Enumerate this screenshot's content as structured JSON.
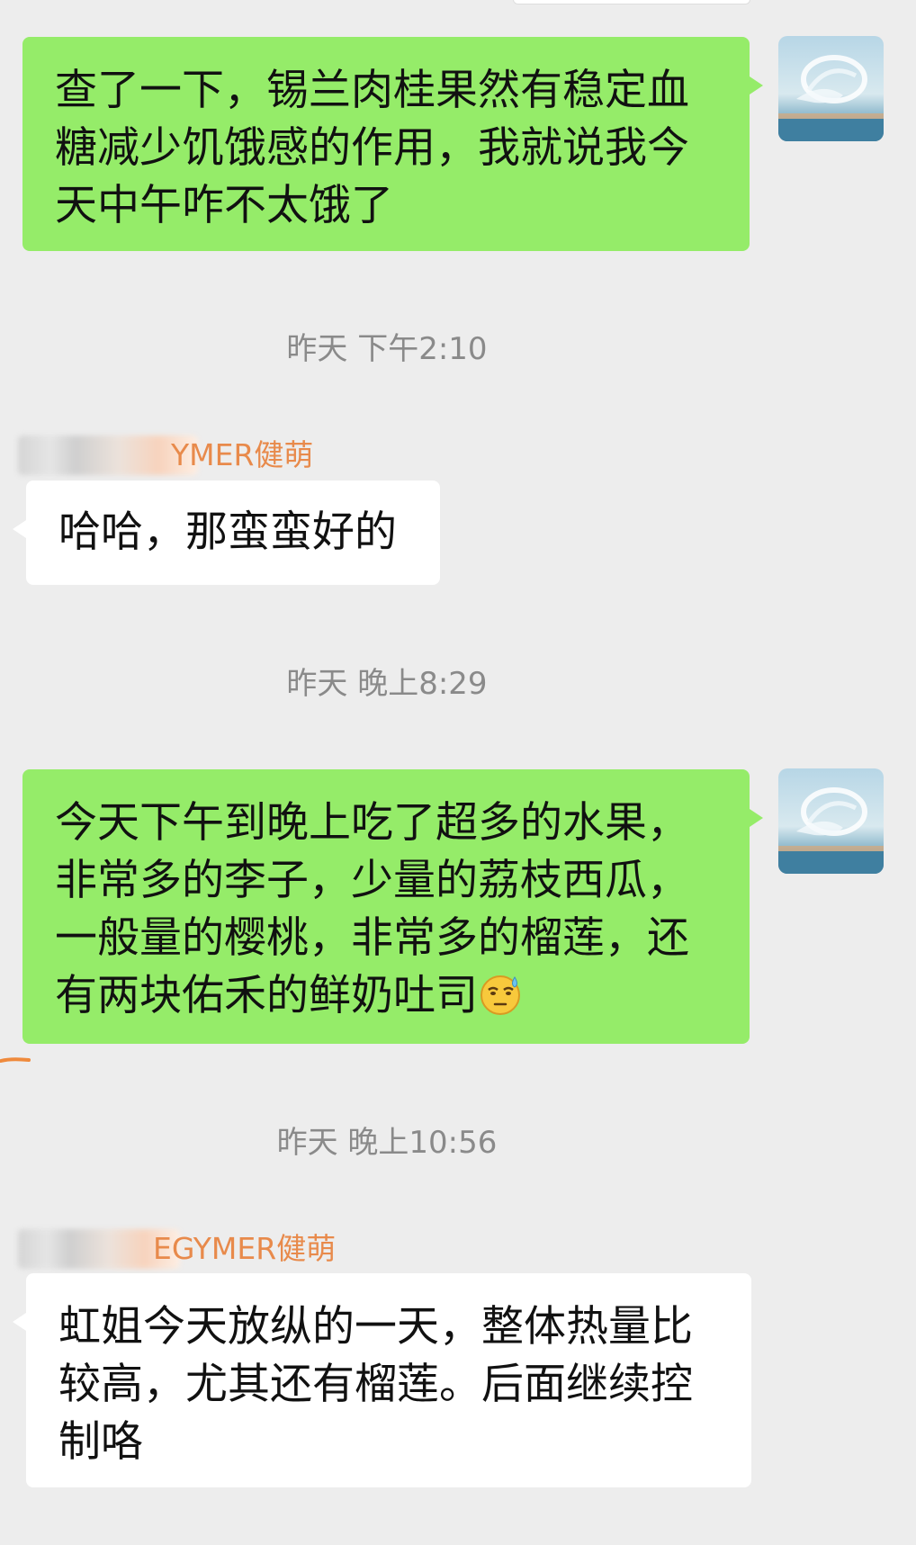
{
  "messages": [
    {
      "type": "outgoing",
      "text": "查了一下，锡兰肉桂果然有稳定血糖减少饥饿感的作用，我就说我今天中午咋不太饿了"
    },
    {
      "type": "timestamp",
      "text": "昨天 下午2:10"
    },
    {
      "type": "incoming",
      "sender_suffix": "YMER健萌",
      "text": "哈哈，那蛮蛮好的"
    },
    {
      "type": "timestamp",
      "text": "昨天 晚上8:29"
    },
    {
      "type": "outgoing",
      "text": "今天下午到晚上吃了超多的水果，非常多的李子，少量的荔枝西瓜，一般量的樱桃，非常多的榴莲，还有两块佑禾的鲜奶吐司",
      "emoji": "sweat-smile-emoji"
    },
    {
      "type": "timestamp",
      "text": "昨天 晚上10:56"
    },
    {
      "type": "incoming",
      "sender_suffix": "EGYMER健萌",
      "text": "虹姐今天放纵的一天，整体热量比较高，尤其还有榴莲。后面继续控制咯"
    }
  ],
  "colors": {
    "background": "#ededed",
    "outgoing_bubble": "#95ec69",
    "incoming_bubble": "#ffffff",
    "timestamp_text": "#8a8a8a",
    "sender_name": "#e88a4b"
  }
}
